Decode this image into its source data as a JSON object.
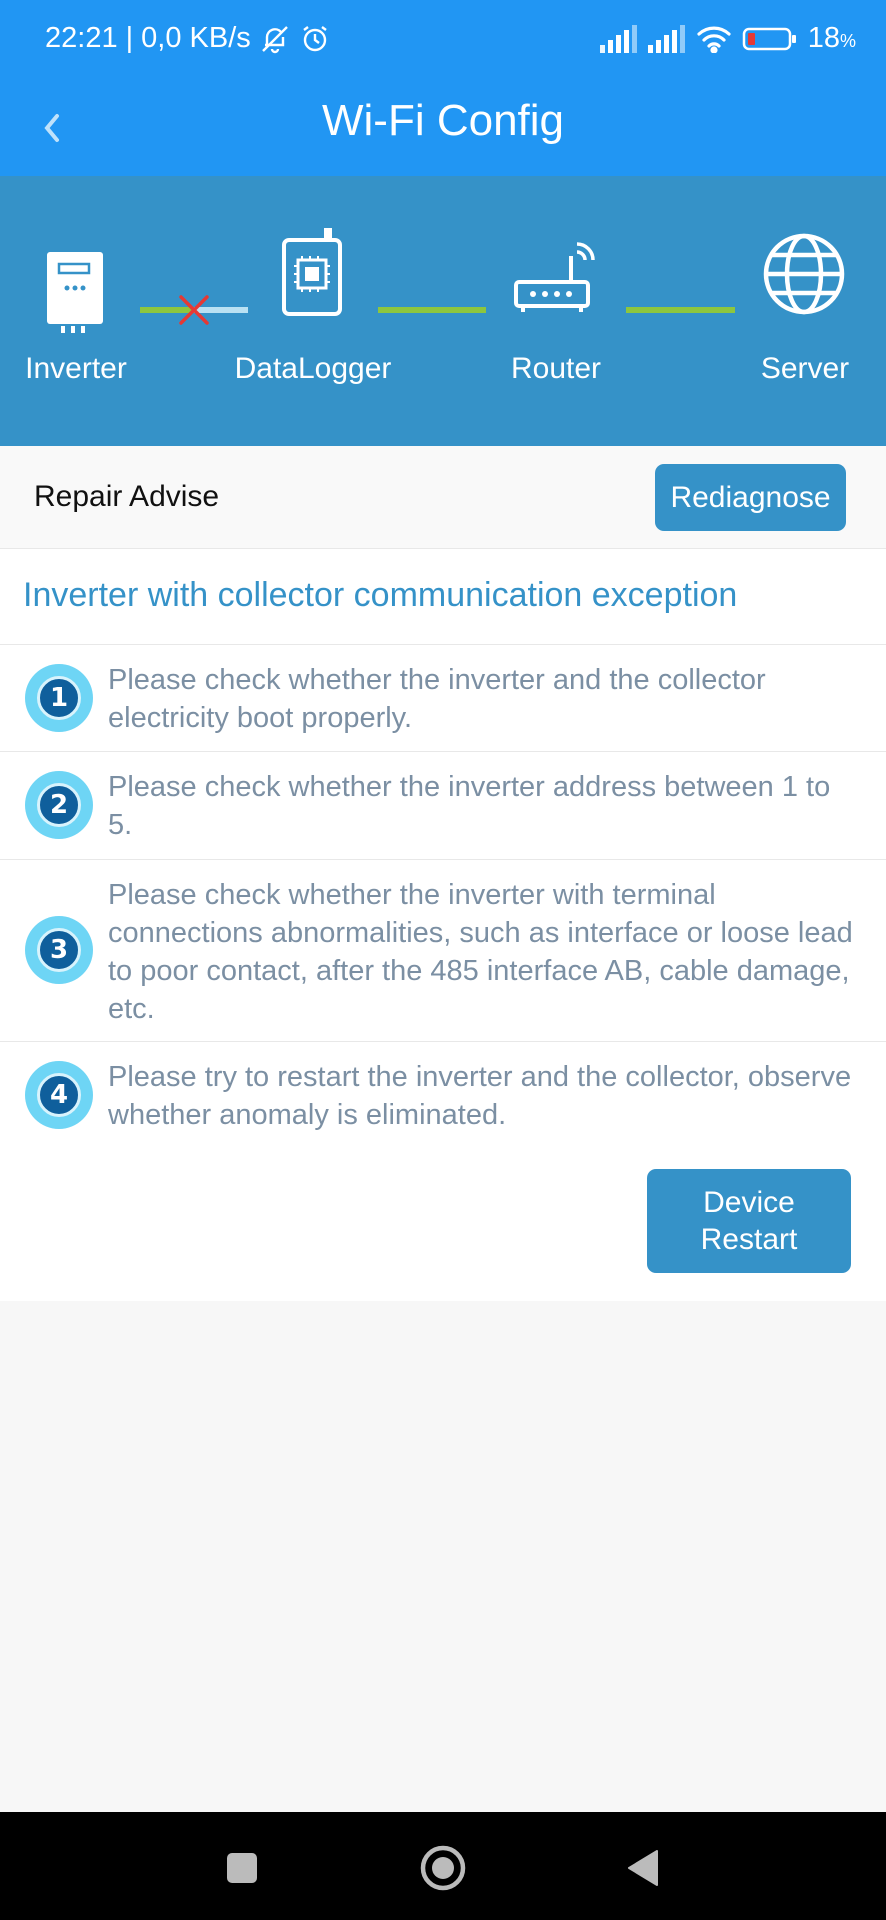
{
  "status_bar": {
    "time": "22:21",
    "net_speed": "| 0,0 KB/s",
    "battery_percent": "18",
    "battery_unit": "%"
  },
  "app_bar": {
    "title": "Wi-Fi Config",
    "back_icon": "chevron-left-icon"
  },
  "diagram": {
    "nodes": [
      {
        "label": "Inverter",
        "icon": "inverter-icon"
      },
      {
        "label": "DataLogger",
        "icon": "datalogger-icon"
      },
      {
        "label": "Router",
        "icon": "router-icon"
      },
      {
        "label": "Server",
        "icon": "globe-icon"
      }
    ],
    "link_ok_color": "#8dc63f",
    "link_error_color": "#e53935"
  },
  "repair": {
    "label": "Repair Advise",
    "rediagnose_label": "Rediagnose",
    "exception_title": "Inverter with collector communication exception",
    "steps": [
      {
        "number": "1",
        "text": "Please check whether the inverter and the collector electricity boot properly."
      },
      {
        "number": "2",
        "text": "Please check whether the inverter address between 1 to 5."
      },
      {
        "number": "3",
        "text": "Please check whether the inverter with terminal connections abnormalities, such as interface or loose lead to poor contact, after the 485 interface AB, cable damage, etc."
      },
      {
        "number": "4",
        "text": "Please try to restart the inverter and the collector, observe whether anomaly is eliminated."
      }
    ],
    "restart_label_line1": "Device",
    "restart_label_line2": "Restart"
  },
  "colors": {
    "primary": "#2196f3",
    "banner": "#3592c8",
    "step_text": "#7b8fa3"
  }
}
